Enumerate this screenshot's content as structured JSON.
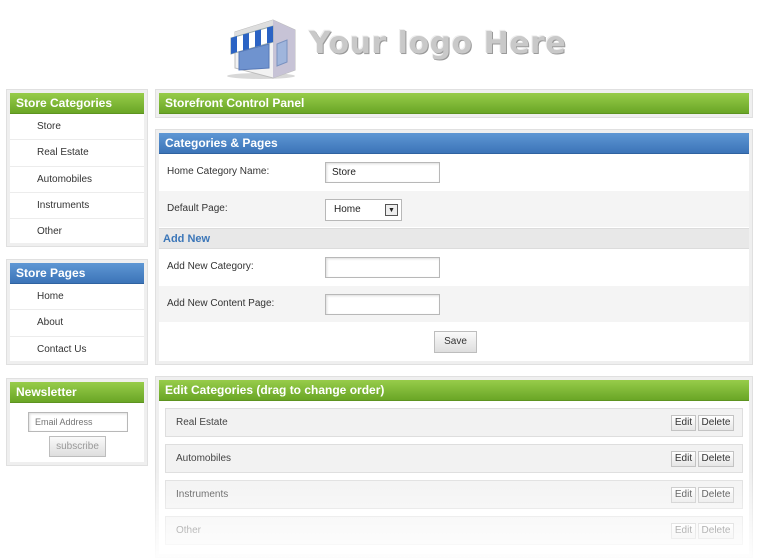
{
  "logo": {
    "text": "Your logo Here",
    "icon": "storefront-icon"
  },
  "sidebar": {
    "categories": {
      "title": "Store Categories",
      "items": [
        "Store",
        "Real Estate",
        "Automobiles",
        "Instruments",
        "Other"
      ]
    },
    "pages": {
      "title": "Store Pages",
      "items": [
        "Home",
        "About",
        "Contact Us"
      ]
    },
    "newsletter": {
      "title": "Newsletter",
      "email_placeholder": "Email Address",
      "subscribe_label": "subscribe"
    }
  },
  "main": {
    "control_panel_title": "Storefront Control Panel",
    "categories_pages": {
      "title": "Categories & Pages",
      "home_category_label": "Home Category Name:",
      "home_category_value": "Store",
      "default_page_label": "Default Page:",
      "default_page_value": "Home",
      "add_new_title": "Add New",
      "new_category_label": "Add New Category:",
      "new_category_value": "",
      "new_page_label": "Add New Content Page:",
      "new_page_value": "",
      "save_label": "Save"
    },
    "edit_categories": {
      "title": "Edit Categories (drag to change order)",
      "edit_label": "Edit",
      "delete_label": "Delete",
      "items": [
        "Real Estate",
        "Automobiles",
        "Instruments",
        "Other"
      ]
    }
  },
  "colors": {
    "green_bar": "#7ab636",
    "blue_bar": "#4a83c6",
    "add_new_text": "#3b76b8"
  }
}
